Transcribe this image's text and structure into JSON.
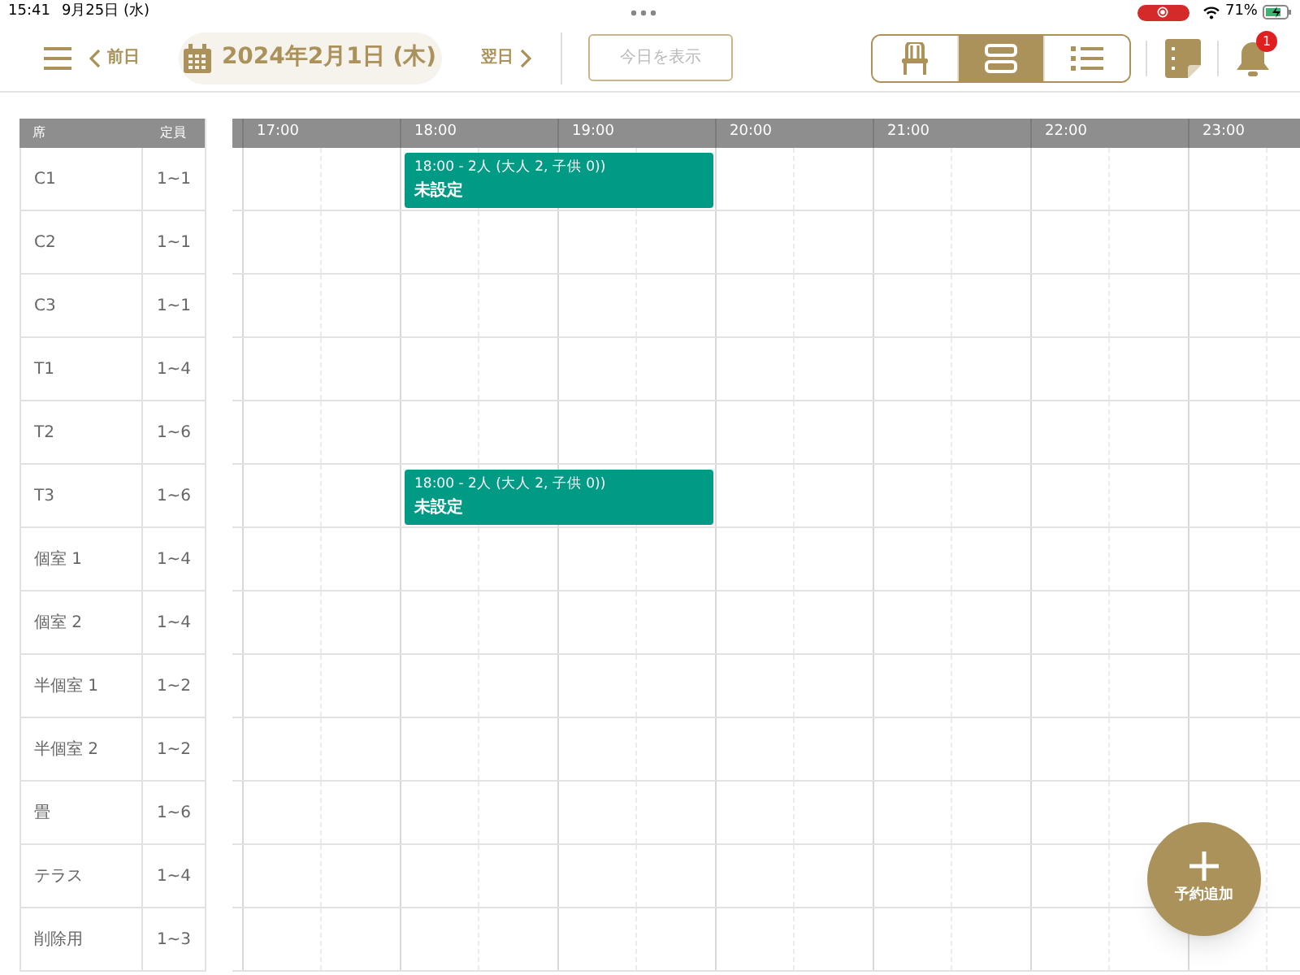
{
  "status_bar": {
    "time": "15:41",
    "date": "9月25日 (水)",
    "battery": "71%"
  },
  "header": {
    "prev": "前日",
    "date": "2024年2月1日 (木)",
    "next": "翌日",
    "today_button": "今日を表示",
    "views": [
      {
        "kind": "seat",
        "selected": false
      },
      {
        "kind": "timeline",
        "selected": true
      },
      {
        "kind": "list",
        "selected": false
      }
    ],
    "notification_count": "1"
  },
  "table": {
    "columns": [
      "席",
      "定員"
    ],
    "hours": [
      "17:00",
      "18:00",
      "19:00",
      "20:00",
      "21:00",
      "22:00",
      "23:00"
    ],
    "rows": [
      {
        "seat": "C1",
        "capacity": "1~1",
        "reservation": {
          "summary": "18:00 - 2人 (大人 2, 子供 0))",
          "status": "未設定"
        }
      },
      {
        "seat": "C2",
        "capacity": "1~1"
      },
      {
        "seat": "C3",
        "capacity": "1~1"
      },
      {
        "seat": "T1",
        "capacity": "1~4"
      },
      {
        "seat": "T2",
        "capacity": "1~6"
      },
      {
        "seat": "T3",
        "capacity": "1~6",
        "reservation": {
          "summary": "18:00 - 2人 (大人 2, 子供 0))",
          "status": "未設定"
        }
      },
      {
        "seat": "個室 1",
        "capacity": "1~4"
      },
      {
        "seat": "個室 2",
        "capacity": "1~4"
      },
      {
        "seat": "半個室 1",
        "capacity": "1~2"
      },
      {
        "seat": "半個室 2",
        "capacity": "1~2"
      },
      {
        "seat": "畳",
        "capacity": "1~6"
      },
      {
        "seat": "テラス",
        "capacity": "1~4"
      },
      {
        "seat": "削除用",
        "capacity": "1~3"
      }
    ]
  },
  "fab": {
    "label": "予約追加"
  }
}
